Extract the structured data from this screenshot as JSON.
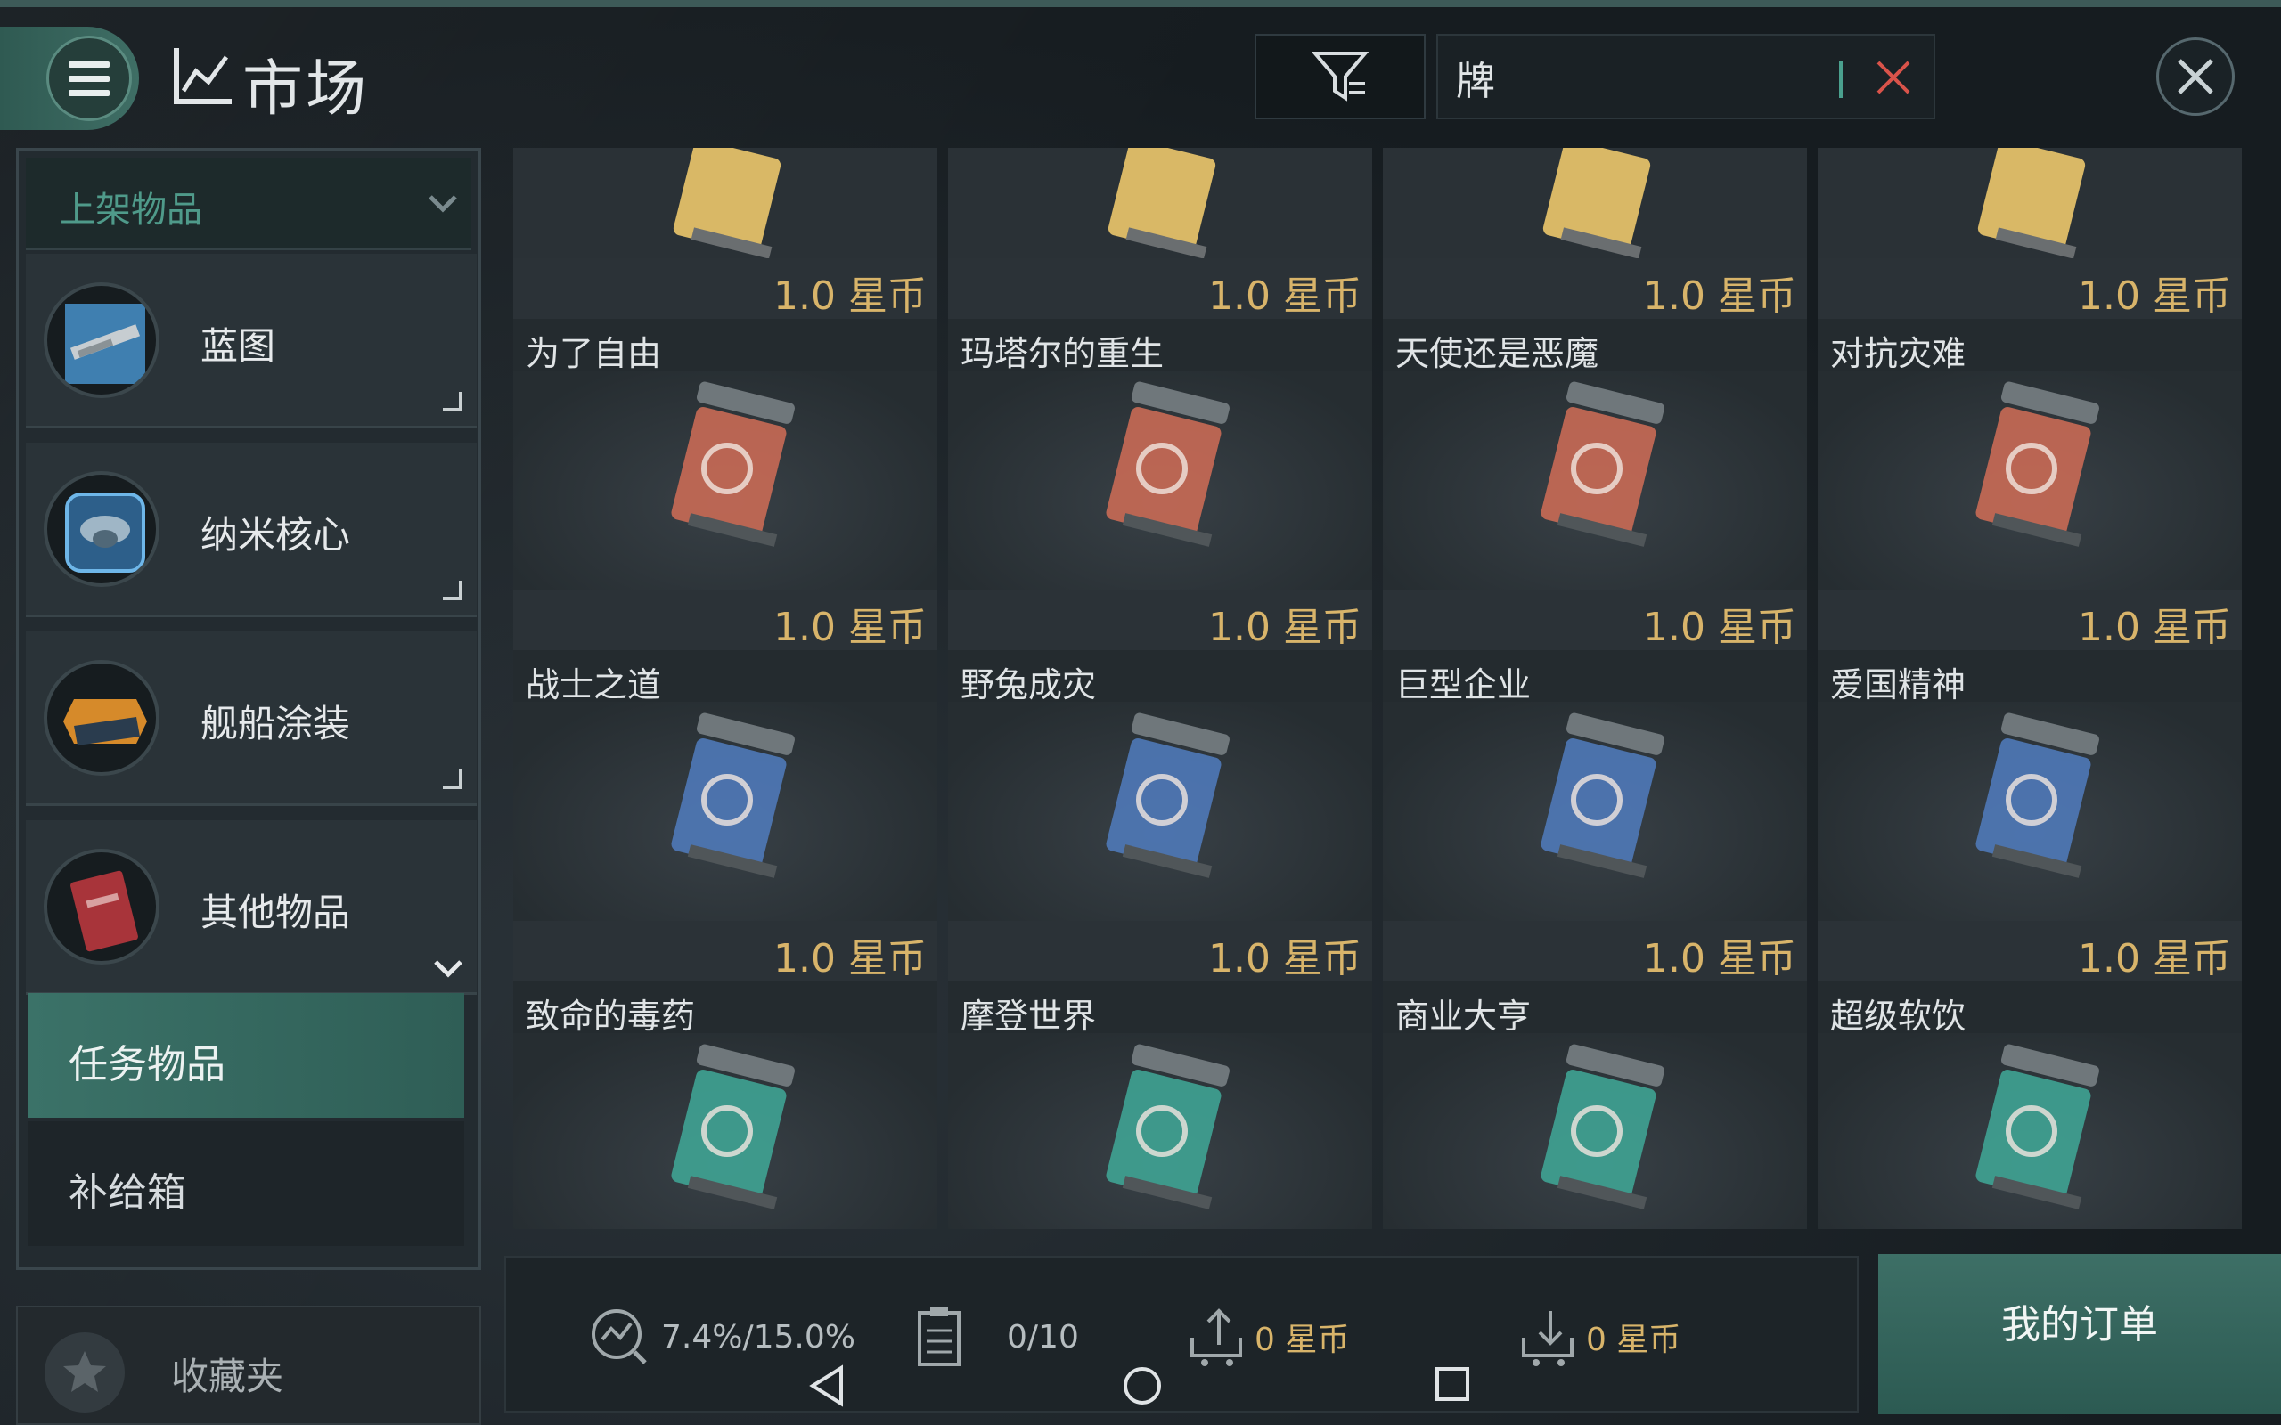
{
  "header": {
    "title": "市场",
    "search_value": "牌"
  },
  "sidebar": {
    "dropdown_label": "上架物品",
    "categories": [
      {
        "label": "蓝图",
        "icon": "blueprint-icon"
      },
      {
        "label": "纳米核心",
        "icon": "nano-core-icon"
      },
      {
        "label": "舰船涂装",
        "icon": "ship-skin-icon"
      },
      {
        "label": "其他物品",
        "icon": "other-items-icon"
      }
    ],
    "subcategories": [
      {
        "label": "任务物品",
        "selected": true
      },
      {
        "label": "补给箱",
        "selected": false
      }
    ],
    "favorites_label": "收藏夹"
  },
  "items": [
    {
      "name": "为了自由",
      "price": "1.0 星币",
      "color": "#c96a55"
    },
    {
      "name": "玛塔尔的重生",
      "price": "1.0 星币",
      "color": "#c96a55"
    },
    {
      "name": "天使还是恶魔",
      "price": "1.0 星币",
      "color": "#c96a55"
    },
    {
      "name": "对抗灾难",
      "price": "1.0 星币",
      "color": "#c96a55"
    },
    {
      "name": "战士之道",
      "price": "1.0 星币",
      "color": "#4f79b8"
    },
    {
      "name": "野兔成灾",
      "price": "1.0 星币",
      "color": "#4f79b8"
    },
    {
      "name": "巨型企业",
      "price": "1.0 星币",
      "color": "#4f79b8"
    },
    {
      "name": "爱国精神",
      "price": "1.0 星币",
      "color": "#4f79b8"
    },
    {
      "name": "致命的毒药",
      "price": "1.0 星币",
      "color": "#3fa394"
    },
    {
      "name": "摩登世界",
      "price": "1.0 星币",
      "color": "#3fa394"
    },
    {
      "name": "商业大亨",
      "price": "1.0 星币",
      "color": "#3fa394"
    },
    {
      "name": "超级软饮",
      "price": "1.0 星币",
      "color": "#3fa394"
    }
  ],
  "top_row_color": "#d9b866",
  "status": {
    "tax_rate": "7.4%/15.0%",
    "orders_count": "0/10",
    "sell_total": "0 星币",
    "buy_total": "0 星币"
  },
  "orders_button_label": "我的订单"
}
